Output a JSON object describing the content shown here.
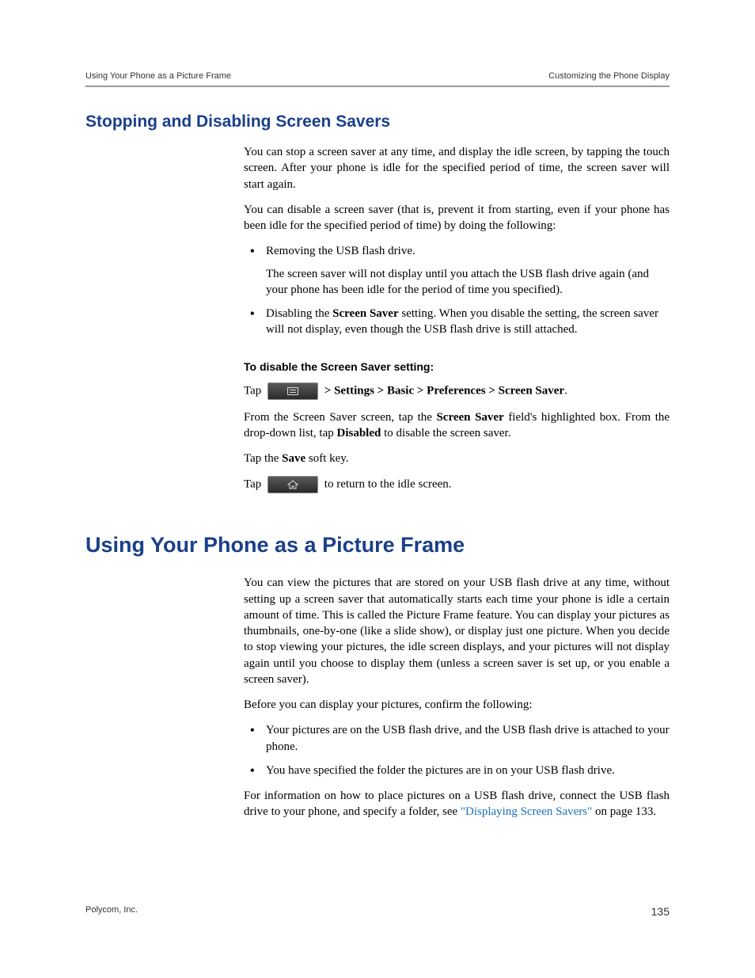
{
  "header": {
    "left": "Using Your Phone as a Picture Frame",
    "right": "Customizing the Phone Display"
  },
  "section1": {
    "heading": "Stopping and Disabling Screen Savers",
    "para1": "You can stop a screen saver at any time, and display the idle screen, by tapping the touch screen. After your phone is idle for the specified period of time, the screen saver will start again.",
    "para2": "You can disable a screen saver (that is, prevent it from starting, even if your phone has been idle for the specified period of time) by doing the following:",
    "bullet1_main": "Removing the USB flash drive.",
    "bullet1_sub": "The screen saver will not display until you attach the USB flash drive again (and your phone has been idle for the period of time you specified).",
    "bullet2_prefix": "Disabling the ",
    "bullet2_bold": "Screen Saver",
    "bullet2_suffix": " setting. When you disable the setting, the screen saver will not display, even though the USB flash drive is still attached.",
    "subheading": "To disable the Screen Saver setting:",
    "step1_prefix": "Tap ",
    "step1_path": "  > Settings > Basic > Preferences > Screen Saver",
    "step1_end": ".",
    "step2_a": "From the Screen Saver screen, tap the ",
    "step2_b": "Screen Saver",
    "step2_c": " field's highlighted box. From the drop-down list, tap ",
    "step2_d": "Disabled",
    "step2_e": " to disable the screen saver.",
    "step3_a": "Tap the ",
    "step3_b": "Save",
    "step3_c": " soft key.",
    "step4_a": "Tap ",
    "step4_b": " to return to the idle screen."
  },
  "section2": {
    "heading": "Using Your Phone as a Picture Frame",
    "para1": "You can view the pictures that are stored on your USB flash drive at any time, without setting up a screen saver that automatically starts each time your phone is idle a certain amount of time. This is called the Picture Frame feature. You can display your pictures as thumbnails, one-by-one (like a slide show), or display just one picture. When you decide to stop viewing your pictures, the idle screen displays, and your pictures will not display again until you choose to display them (unless a screen saver is set up, or you enable a screen saver).",
    "para2": "Before you can display your pictures, confirm the following:",
    "bullet1": "Your pictures are on the USB flash drive, and the USB flash drive is attached to your phone.",
    "bullet2": "You have specified the folder the pictures are in on your USB flash drive.",
    "para3_a": "For information on how to place pictures on a USB flash drive, connect the USB flash drive to your phone, and specify a folder, see ",
    "para3_link": "\"Displaying Screen Savers\"",
    "para3_b": " on page 133."
  },
  "footer": {
    "left": "Polycom, Inc.",
    "right": "135"
  }
}
